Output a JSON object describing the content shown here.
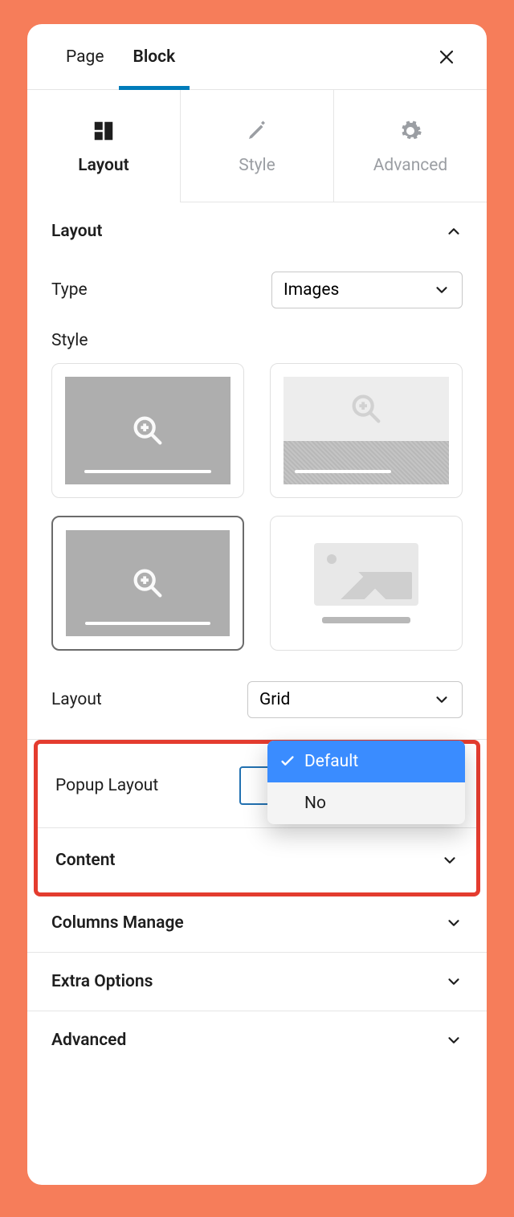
{
  "header": {
    "tabs": {
      "page": "Page",
      "block": "Block"
    }
  },
  "subtabs": {
    "layout": "Layout",
    "style": "Style",
    "advanced": "Advanced"
  },
  "sections": {
    "layout": {
      "title": "Layout",
      "type_label": "Type",
      "type_value": "Images",
      "style_label": "Style",
      "layout_label": "Layout",
      "layout_value": "Grid"
    },
    "popup": {
      "label": "Popup Layout",
      "options": {
        "default": "Default",
        "no": "No"
      }
    },
    "content": "Content",
    "columns": "Columns Manage",
    "extra": "Extra Options",
    "advanced": "Advanced"
  }
}
